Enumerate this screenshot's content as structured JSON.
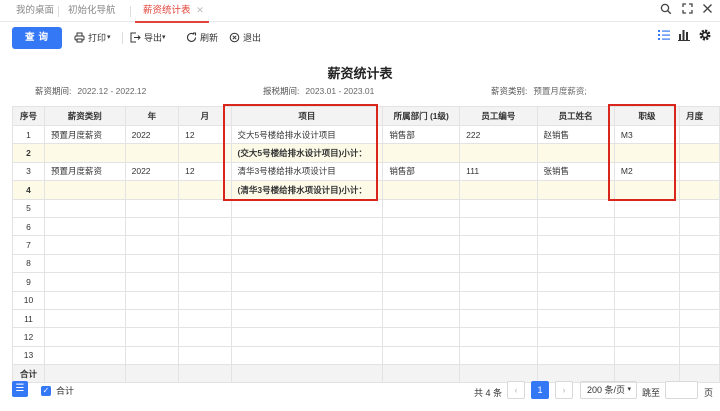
{
  "tabs": [
    {
      "label": "我的桌面",
      "active": false
    },
    {
      "label": "初始化导航",
      "active": false
    },
    {
      "label": "薪资统计表",
      "active": true
    }
  ],
  "toolbar": {
    "query_label": "查询",
    "print_label": "打印",
    "export_label": "导出",
    "refresh_label": "刷新",
    "exit_label": "退出"
  },
  "report": {
    "title": "薪资统计表",
    "salary_period_label": "薪资期间:",
    "salary_period_value": "2022.12 - 2022.12",
    "tax_period_label": "报税期间:",
    "tax_period_value": "2023.01 - 2023.01",
    "salary_type_label": "薪资类别:",
    "salary_type_value": "预置月度薪资;"
  },
  "table": {
    "columns": [
      "序号",
      "薪资类别",
      "年",
      "月",
      "项目",
      "所属部门 (1级)",
      "员工编号",
      "员工姓名",
      "职级",
      "月度"
    ],
    "rows": [
      {
        "type": "data",
        "cells": [
          "1",
          "预置月度薪资",
          "2022",
          "12",
          "交大5号楼给排水设计项目",
          "销售部",
          "222",
          "赵销售",
          "M3",
          ""
        ]
      },
      {
        "type": "sub",
        "cells": [
          "2",
          "",
          "",
          "",
          "(交大5号楼给排水设计项目)小计：",
          "",
          "",
          "",
          "",
          ""
        ]
      },
      {
        "type": "data",
        "cells": [
          "3",
          "预置月度薪资",
          "2022",
          "12",
          "清华3号楼给排水项设计目",
          "销售部",
          "111",
          "张销售",
          "M2",
          ""
        ]
      },
      {
        "type": "sub",
        "cells": [
          "4",
          "",
          "",
          "",
          "(清华3号楼给排水项设计目)小计：",
          "",
          "",
          "",
          "",
          ""
        ]
      },
      {
        "type": "empty",
        "cells": [
          "5",
          "",
          "",
          "",
          "",
          "",
          "",
          "",
          "",
          ""
        ]
      },
      {
        "type": "empty",
        "cells": [
          "6",
          "",
          "",
          "",
          "",
          "",
          "",
          "",
          "",
          ""
        ]
      },
      {
        "type": "empty",
        "cells": [
          "7",
          "",
          "",
          "",
          "",
          "",
          "",
          "",
          "",
          ""
        ]
      },
      {
        "type": "empty",
        "cells": [
          "8",
          "",
          "",
          "",
          "",
          "",
          "",
          "",
          "",
          ""
        ]
      },
      {
        "type": "empty",
        "cells": [
          "9",
          "",
          "",
          "",
          "",
          "",
          "",
          "",
          "",
          ""
        ]
      },
      {
        "type": "empty",
        "cells": [
          "10",
          "",
          "",
          "",
          "",
          "",
          "",
          "",
          "",
          ""
        ]
      },
      {
        "type": "empty",
        "cells": [
          "11",
          "",
          "",
          "",
          "",
          "",
          "",
          "",
          "",
          ""
        ]
      },
      {
        "type": "empty",
        "cells": [
          "12",
          "",
          "",
          "",
          "",
          "",
          "",
          "",
          "",
          ""
        ]
      },
      {
        "type": "empty",
        "cells": [
          "13",
          "",
          "",
          "",
          "",
          "",
          "",
          "",
          "",
          ""
        ]
      },
      {
        "type": "total",
        "cells": [
          "合计",
          "",
          "",
          "",
          "",
          "",
          "",
          "",
          "",
          ""
        ]
      }
    ]
  },
  "footer": {
    "total_checkbox_label": "合计",
    "total_count": "共 4 条",
    "current_page": "1",
    "page_size": "200 条/页",
    "jump_label": "跳至",
    "page_unit": "页"
  },
  "colors": {
    "accent": "#3478f6",
    "active_tab": "#e0453a",
    "highlight_box": "#d9261c",
    "subtotal_row": "#fdfbe8"
  }
}
